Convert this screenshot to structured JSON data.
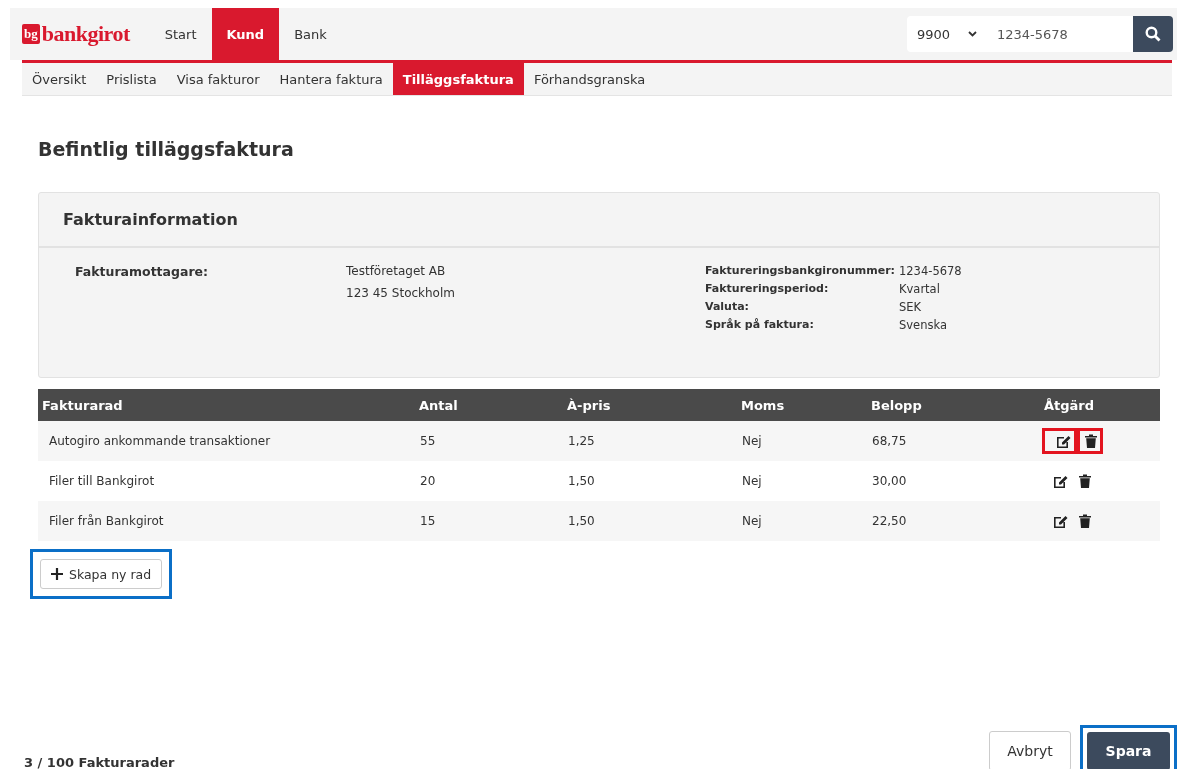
{
  "header": {
    "logo_mark": "bg",
    "logo_text": "bankgirot",
    "nav": [
      {
        "label": "Start",
        "selected": false
      },
      {
        "label": "Kund",
        "selected": true
      },
      {
        "label": "Bank",
        "selected": false
      }
    ],
    "search": {
      "select_value": "9900",
      "value": "1234-5678"
    }
  },
  "subnav": [
    {
      "label": "Översikt",
      "selected": false
    },
    {
      "label": "Prislista",
      "selected": false
    },
    {
      "label": "Visa fakturor",
      "selected": false
    },
    {
      "label": "Hantera faktura",
      "selected": false
    },
    {
      "label": "Tilläggsfaktura",
      "selected": true
    },
    {
      "label": "Förhandsgranska",
      "selected": false
    }
  ],
  "page_title": "Befintlig tilläggsfaktura",
  "info_card": {
    "title": "Fakturainformation",
    "recipient_label": "Fakturamottagare:",
    "recipient_lines": [
      "Testföretaget AB",
      "123 45 Stockholm"
    ],
    "details": [
      {
        "label": "Faktureringsbankgironummer:",
        "value": "1234-5678"
      },
      {
        "label": "Faktureringsperiod:",
        "value": "Kvartal"
      },
      {
        "label": "Valuta:",
        "value": "SEK"
      },
      {
        "label": "Språk på faktura:",
        "value": "Svenska"
      }
    ]
  },
  "table": {
    "columns": [
      "Fakturarad",
      "Antal",
      "À-pris",
      "Moms",
      "Belopp",
      "Åtgärd"
    ],
    "rows": [
      {
        "cells": [
          "Autogiro ankommande transaktioner",
          "55",
          "1,25",
          "Nej",
          "68,75"
        ],
        "highlighted": true
      },
      {
        "cells": [
          "Filer till Bankgirot",
          "20",
          "1,50",
          "Nej",
          "30,00"
        ],
        "highlighted": false
      },
      {
        "cells": [
          "Filer från Bankgirot",
          "15",
          "1,50",
          "Nej",
          "22,50"
        ],
        "highlighted": false
      }
    ]
  },
  "add_row_button": {
    "label": "Skapa ny rad",
    "highlighted": true
  },
  "footer": {
    "count": "3 / 100 Fakturarader",
    "cancel": {
      "label": "Avbryt",
      "highlighted": false
    },
    "save": {
      "label": "Spara",
      "highlighted": true
    }
  }
}
